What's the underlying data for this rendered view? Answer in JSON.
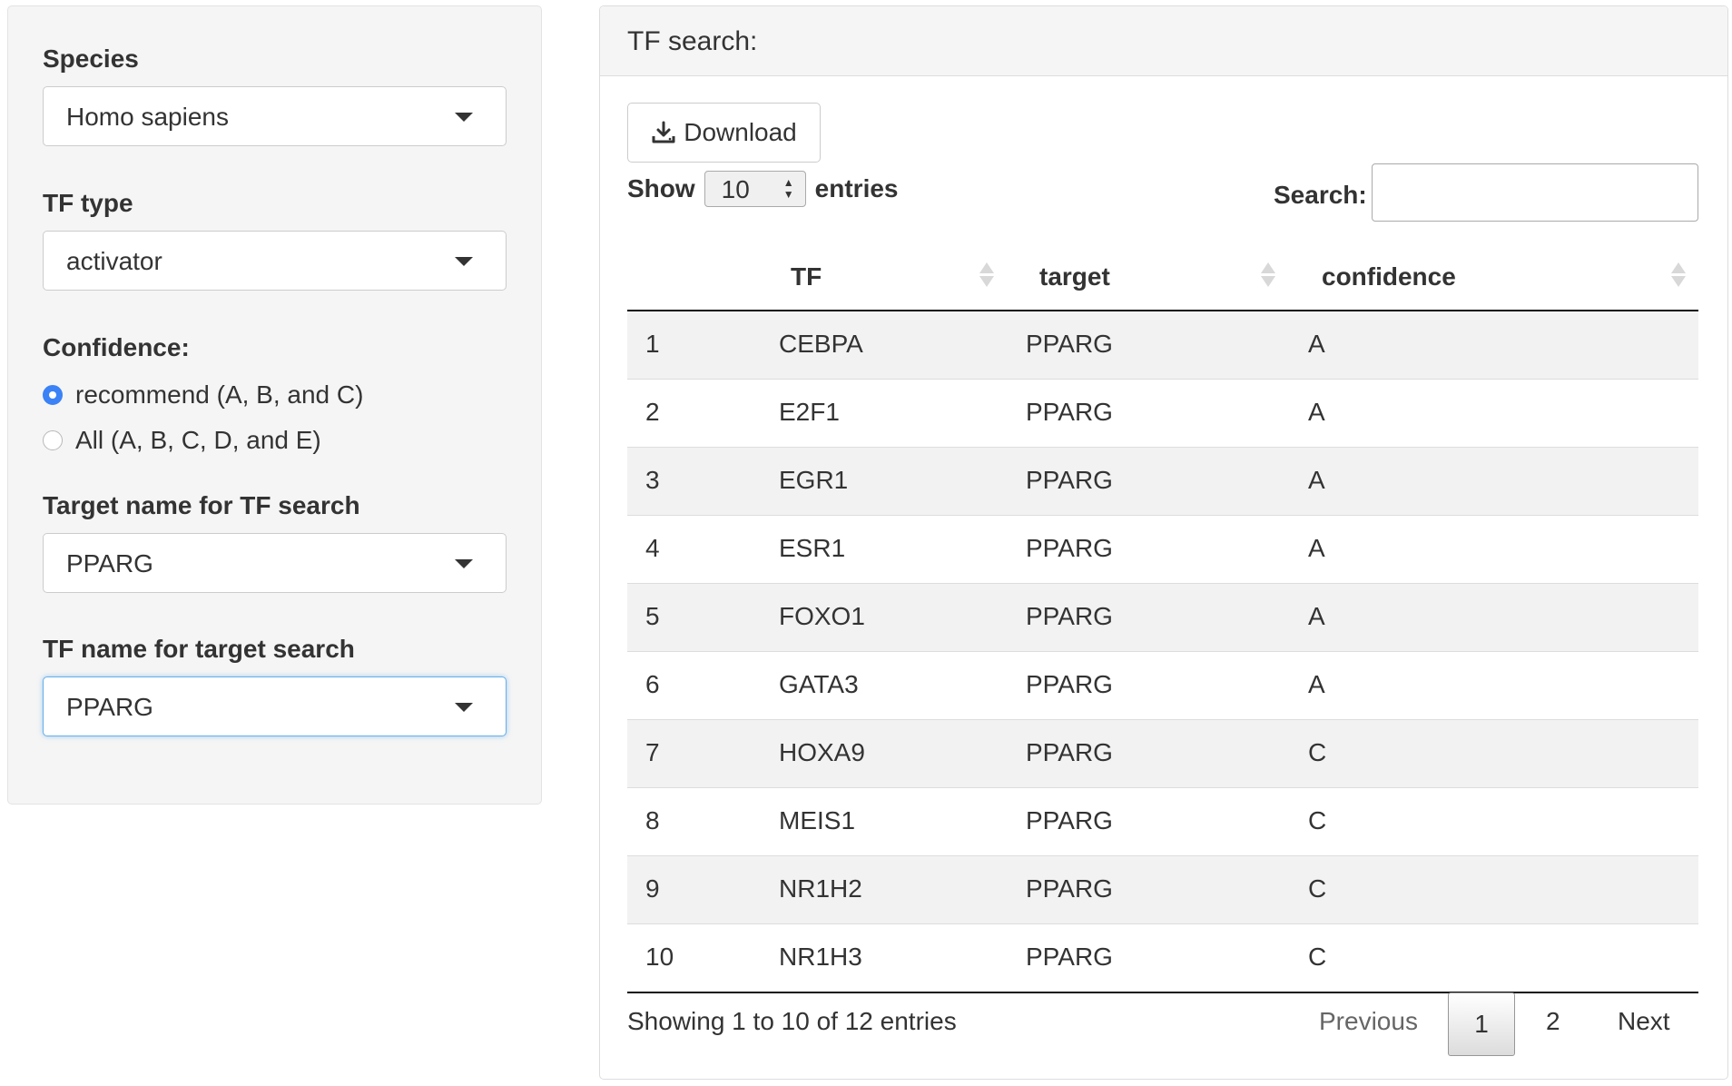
{
  "sidebar": {
    "species": {
      "label": "Species",
      "value": "Homo sapiens"
    },
    "tf_type": {
      "label": "TF type",
      "value": "activator"
    },
    "confidence": {
      "label": "Confidence:",
      "options": [
        {
          "label": "recommend (A, B, and C)",
          "checked": true
        },
        {
          "label": "All (A, B, C, D, and E)",
          "checked": false
        }
      ]
    },
    "target_name": {
      "label": "Target name for TF search",
      "value": "PPARG"
    },
    "tf_name": {
      "label": "TF name for target search",
      "value": "PPARG"
    }
  },
  "main": {
    "title": "TF search:",
    "download_label": "Download",
    "show_label": "Show",
    "entries_value": "10",
    "entries_label": "entries",
    "search_label": "Search:",
    "search_value": "",
    "columns": [
      "",
      "TF",
      "target",
      "confidence"
    ],
    "rows": [
      [
        "1",
        "CEBPA",
        "PPARG",
        "A"
      ],
      [
        "2",
        "E2F1",
        "PPARG",
        "A"
      ],
      [
        "3",
        "EGR1",
        "PPARG",
        "A"
      ],
      [
        "4",
        "ESR1",
        "PPARG",
        "A"
      ],
      [
        "5",
        "FOXO1",
        "PPARG",
        "A"
      ],
      [
        "6",
        "GATA3",
        "PPARG",
        "A"
      ],
      [
        "7",
        "HOXA9",
        "PPARG",
        "C"
      ],
      [
        "8",
        "MEIS1",
        "PPARG",
        "C"
      ],
      [
        "9",
        "NR1H2",
        "PPARG",
        "C"
      ],
      [
        "10",
        "NR1H3",
        "PPARG",
        "C"
      ]
    ],
    "info": "Showing 1 to 10 of 12 entries",
    "pagination": {
      "previous": "Previous",
      "pages": [
        "1",
        "2"
      ],
      "current": "1",
      "next": "Next"
    }
  },
  "colors": {
    "radio_accent": "#3b82f6",
    "focus_border": "#66afe9",
    "sidebar_bg": "#f5f5f5"
  },
  "icons": {
    "download": "download-icon",
    "dropdown": "chevron-down-icon"
  }
}
